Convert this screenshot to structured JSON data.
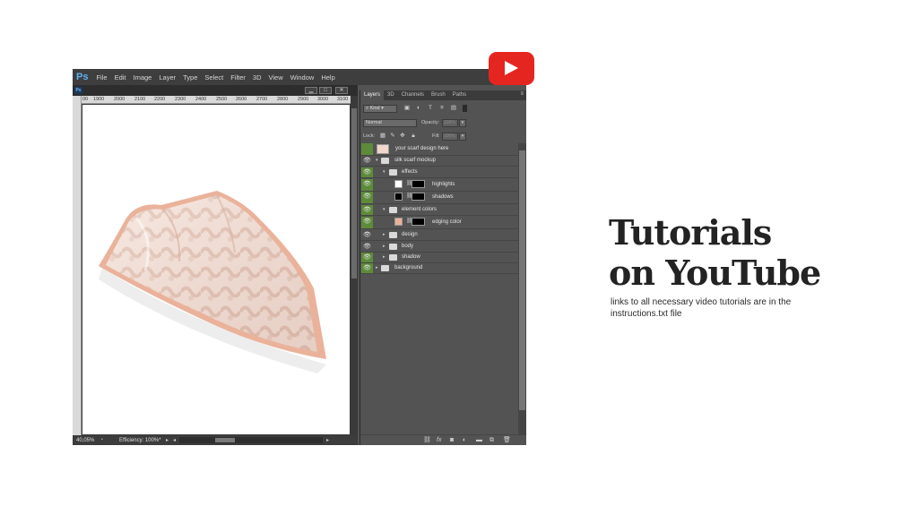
{
  "photoshop": {
    "logo": "Ps",
    "menu": [
      "File",
      "Edit",
      "Image",
      "Layer",
      "Type",
      "Select",
      "Filter",
      "3D",
      "View",
      "Window",
      "Help"
    ],
    "document": {
      "icon": "Ps",
      "ruler_labels": [
        "00",
        "1900",
        "2000",
        "2100",
        "2200",
        "2300",
        "2400",
        "2500",
        "2600",
        "2700",
        "2800",
        "2900",
        "3000",
        "3100"
      ],
      "zoom": "40,05%",
      "efficiency": "Efficiency: 100%*"
    },
    "layers_panel": {
      "tabs": [
        "Layers",
        "3D",
        "Channels",
        "Brush",
        "Paths"
      ],
      "active_tab": "Layers",
      "filter_kind": "Kind",
      "blend_mode": "Normal",
      "opacity_label": "Opacity:",
      "opacity_value": "100%",
      "lock_label": "Lock:",
      "fill_label": "Fill:",
      "fill_value": "100%",
      "layers": [
        {
          "name": "your scarf design here",
          "visible": false,
          "highlighted": true,
          "kind": "smart-object"
        },
        {
          "name": "silk scarf mockup",
          "visible": true,
          "highlighted": false,
          "kind": "group-open"
        },
        {
          "name": "effects",
          "visible": true,
          "highlighted": true,
          "kind": "group-open"
        },
        {
          "name": "highlights",
          "visible": true,
          "highlighted": true,
          "kind": "layer-mask"
        },
        {
          "name": "shadows",
          "visible": true,
          "highlighted": true,
          "kind": "layer-mask"
        },
        {
          "name": "element colors",
          "visible": true,
          "highlighted": true,
          "kind": "group-open"
        },
        {
          "name": "edging color",
          "visible": true,
          "highlighted": true,
          "kind": "fill-mask"
        },
        {
          "name": "design",
          "visible": true,
          "highlighted": false,
          "kind": "group-closed"
        },
        {
          "name": "body",
          "visible": true,
          "highlighted": false,
          "kind": "group-closed"
        },
        {
          "name": "shadow",
          "visible": true,
          "highlighted": true,
          "kind": "group-closed"
        },
        {
          "name": "background",
          "visible": true,
          "highlighted": true,
          "kind": "group-closed"
        }
      ]
    }
  },
  "heading_line1": "Tutorials",
  "heading_line2": "on YouTube",
  "description": "links to all necessary video tutorials are in the instructions.txt file",
  "colors": {
    "youtube_red": "#e52620",
    "layer_green": "#5d8b3a",
    "scarf_pink": "#f4dcd2",
    "scarf_edge": "#eab29a"
  },
  "icons": [
    "youtube-play-icon",
    "eye-icon",
    "folder-icon",
    "chain-icon",
    "search-icon"
  ]
}
